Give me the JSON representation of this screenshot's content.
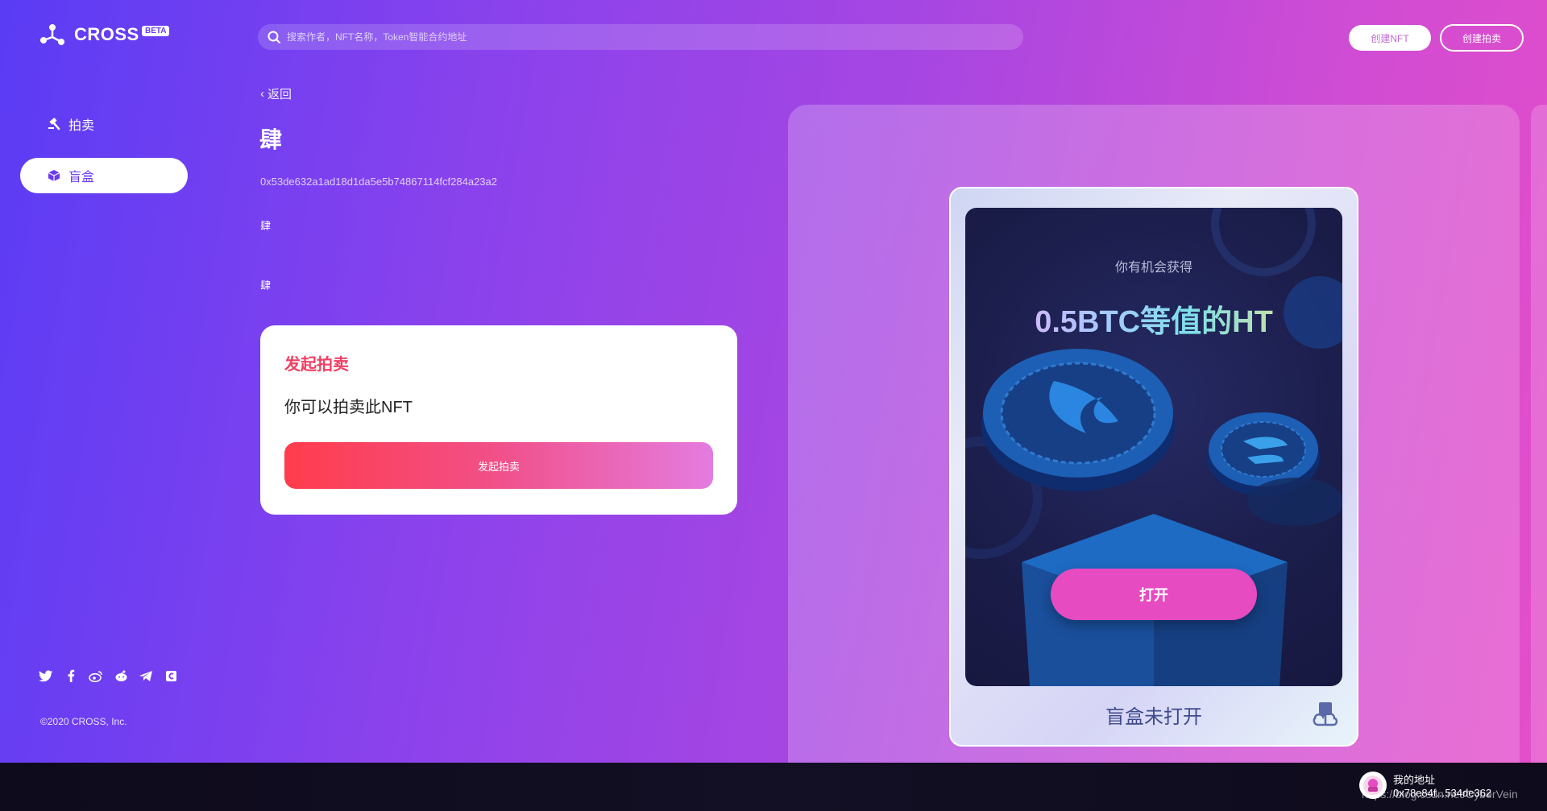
{
  "brand": {
    "name": "CROSS",
    "badge": "BETA"
  },
  "sidebar": {
    "items": [
      {
        "label": "拍卖",
        "icon": "gavel-icon"
      },
      {
        "label": "盲盒",
        "icon": "box-icon"
      }
    ],
    "social": [
      "twitter-icon",
      "facebook-icon",
      "weibo-icon",
      "reddit-icon",
      "telegram-icon",
      "coinmarket-icon"
    ],
    "copyright": "©2020 CROSS, Inc."
  },
  "header": {
    "search_placeholder": "搜索作者，NFT名称，Token智能合约地址",
    "create_nft_label": "创建NFT",
    "create_auction_label": "创建拍卖"
  },
  "detail": {
    "back_label": "返回",
    "title": "肆",
    "address": "0x53de632a1ad18d1da5e5b74867114fcf284a23a2",
    "field1": "肆",
    "field2": "肆"
  },
  "auction_card": {
    "heading": "发起拍卖",
    "description": "你可以拍卖此NFT",
    "button_label": "发起拍卖"
  },
  "blind_box": {
    "chance_text": "你有机会获得",
    "prize_text": "0.5BTC等值的HT",
    "open_button_label": "打开",
    "status_text": "盲盒未打开"
  },
  "wallet": {
    "label": "我的地址",
    "address": "0x78e84f...534de362"
  },
  "watermark": "https://blog.csdn.net/CyberVein",
  "colors": {
    "accent_red": "#f23f63",
    "accent_pink": "#e64bc1",
    "brand_purple": "#6a3cf0"
  }
}
